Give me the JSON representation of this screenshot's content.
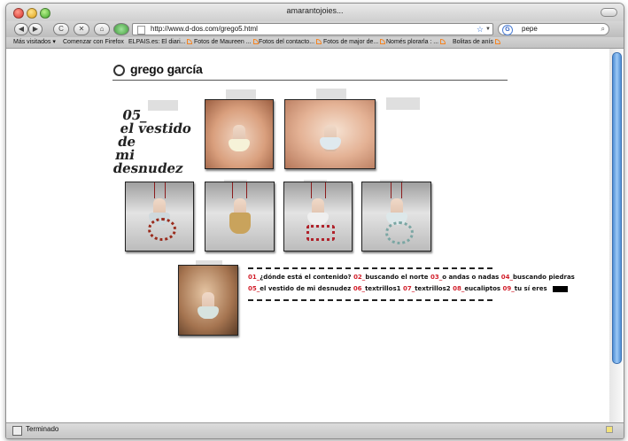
{
  "window": {
    "title": "amarantojoies..."
  },
  "toolbar": {
    "url": "http://www.d-dos.com/grego5.html",
    "search_value": "pepe",
    "back_label": "◀",
    "forward_label": "▶",
    "reload_label": "C",
    "stop_label": "✕",
    "home_label": "⌂"
  },
  "bookmarks": [
    {
      "label": "Más visitados",
      "has_menu": true
    },
    {
      "label": "Comenzar con Firefox"
    },
    {
      "label": "ELPAIS.es: El diari...",
      "rss": true
    },
    {
      "label": "Fotos de Maureen ...",
      "rss": true
    },
    {
      "label": "Fotos del contacto...",
      "rss": true
    },
    {
      "label": "Fotos de major de...",
      "rss": true
    },
    {
      "label": "Només plorarla : ...",
      "rss": true
    },
    {
      "label": "Bolitas de anís",
      "rss": true
    }
  ],
  "site": {
    "title": "grego garcía",
    "section_title_lines": [
      "05_",
      "el vestido de",
      "mi desnudez"
    ]
  },
  "toc": {
    "line1": [
      {
        "num": "01_",
        "text": "¿dónde está el contenido?"
      },
      {
        "num": "02_",
        "text": "buscando el norte"
      },
      {
        "num": "03_",
        "text": "o andas o nadas"
      },
      {
        "num": "04_",
        "text": "buscando piedras"
      }
    ],
    "line2": [
      {
        "num": "05_",
        "text": "el vestido de mi desnudez"
      },
      {
        "num": "06_",
        "text": "textrillos1"
      },
      {
        "num": "07_",
        "text": "textrillos2"
      },
      {
        "num": "08_",
        "text": "eucaliptos"
      },
      {
        "num": "09_",
        "text": "tu sí eres"
      }
    ]
  },
  "status": {
    "text": "Terminado"
  },
  "colors": {
    "toc_number": "#d21f2b",
    "scroll_thumb": "#4f8fd6"
  }
}
